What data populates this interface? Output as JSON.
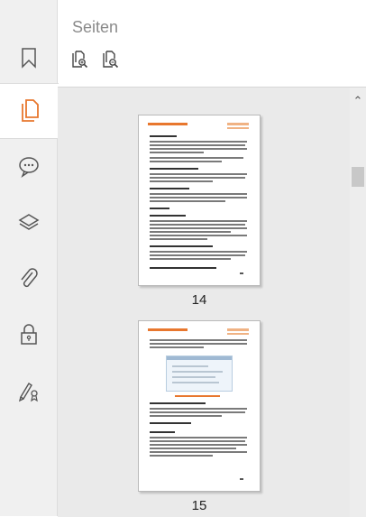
{
  "panel": {
    "title": "Seiten"
  },
  "rail": {
    "items": [
      {
        "icon": "bookmark-icon",
        "active": false
      },
      {
        "icon": "pages-icon",
        "active": true
      },
      {
        "icon": "comment-icon",
        "active": false
      },
      {
        "icon": "layers-icon",
        "active": false
      },
      {
        "icon": "attachment-icon",
        "active": false
      },
      {
        "icon": "security-lock-icon",
        "active": false
      },
      {
        "icon": "signature-icon",
        "active": false
      }
    ]
  },
  "toolbar": {
    "tools": [
      "zoom-in-thumbnails-icon",
      "zoom-out-thumbnails-icon"
    ]
  },
  "pages": [
    {
      "number": "14"
    },
    {
      "number": "15"
    }
  ],
  "colors": {
    "accent": "#e8772e",
    "rail_bg": "#f0f0f0",
    "pane_bg": "#eaeaea"
  }
}
